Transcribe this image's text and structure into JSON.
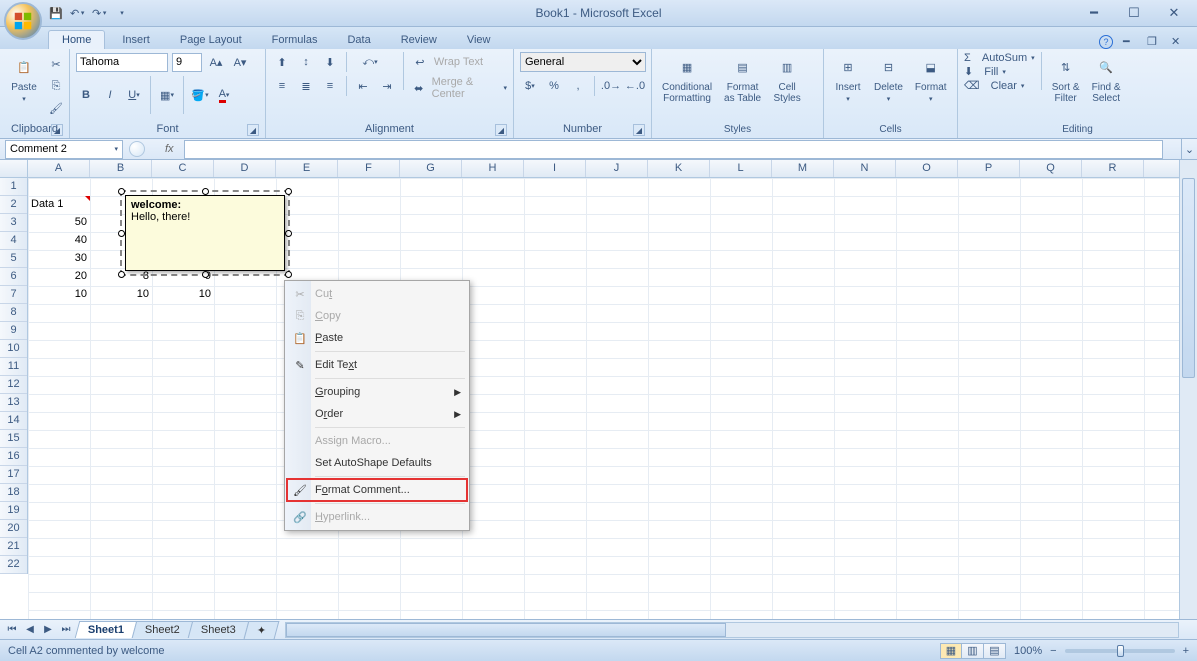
{
  "title": "Book1 - Microsoft Excel",
  "qat": {
    "save": "save-icon",
    "undo": "undo-icon",
    "redo": "redo-icon"
  },
  "tabs": [
    "Home",
    "Insert",
    "Page Layout",
    "Formulas",
    "Data",
    "Review",
    "View"
  ],
  "active_tab": 0,
  "ribbon": {
    "clipboard": {
      "label": "Clipboard",
      "paste": "Paste"
    },
    "font": {
      "label": "Font",
      "name": "Tahoma",
      "size": "9"
    },
    "alignment": {
      "label": "Alignment",
      "wrap": "Wrap Text",
      "merge": "Merge & Center"
    },
    "number": {
      "label": "Number",
      "format": "General"
    },
    "styles": {
      "label": "Styles",
      "cond": "Conditional\nFormatting",
      "table": "Format\nas Table",
      "cell": "Cell\nStyles"
    },
    "cells": {
      "label": "Cells",
      "insert": "Insert",
      "delete": "Delete",
      "format": "Format"
    },
    "editing": {
      "label": "Editing",
      "autosum": "AutoSum",
      "fill": "Fill",
      "clear": "Clear",
      "sort": "Sort &\nFilter",
      "find": "Find &\nSelect"
    }
  },
  "namebox": "Comment 2",
  "cells": {
    "A2": "Data 1",
    "A3": "50",
    "A4": "40",
    "A5": "30",
    "A6": "20",
    "A7": "10",
    "B6": "8",
    "B7": "10",
    "C6": "9",
    "C7": "10"
  },
  "columns": [
    "A",
    "B",
    "C",
    "D",
    "E",
    "F",
    "G",
    "H",
    "I",
    "J",
    "K",
    "L",
    "M",
    "N",
    "O",
    "P",
    "Q",
    "R"
  ],
  "rows": 22,
  "comment": {
    "author": "welcome:",
    "text": "Hello, there!"
  },
  "context_menu": [
    {
      "label": "Cut",
      "u": "t",
      "dis": true,
      "icon": "cut-icon"
    },
    {
      "label": "Copy",
      "u": "C",
      "dis": true,
      "icon": "copy-icon"
    },
    {
      "label": "Paste",
      "u": "P",
      "icon": "paste-icon"
    },
    {
      "sep": true
    },
    {
      "label": "Edit Text",
      "u": "x",
      "icon": "edit-text-icon"
    },
    {
      "sep": true
    },
    {
      "label": "Grouping",
      "u": "G",
      "sub": true
    },
    {
      "label": "Order",
      "u": "r",
      "sub": true
    },
    {
      "sep": true
    },
    {
      "label": "Assign Macro...",
      "u": "",
      "dis": true
    },
    {
      "label": "Set AutoShape Defaults",
      "u": ""
    },
    {
      "sep": true
    },
    {
      "label": "Format Comment...",
      "u": "o",
      "icon": "format-comment-icon",
      "hl": true
    },
    {
      "sep": true
    },
    {
      "label": "Hyperlink...",
      "u": "H",
      "dis": true,
      "icon": "hyperlink-icon"
    }
  ],
  "sheets": [
    "Sheet1",
    "Sheet2",
    "Sheet3"
  ],
  "active_sheet": 0,
  "status": "Cell A2 commented by welcome",
  "zoom": "100%"
}
